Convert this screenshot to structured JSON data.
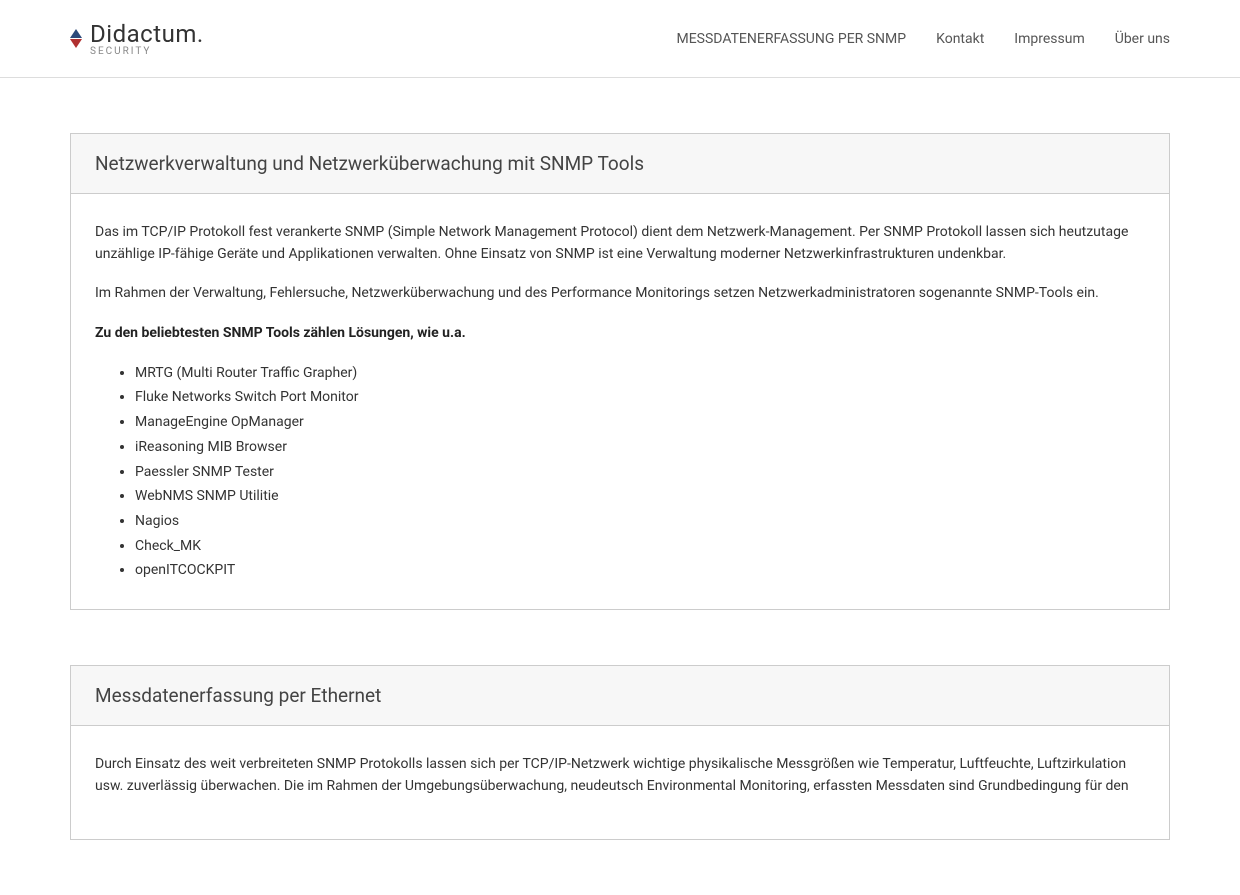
{
  "logo": {
    "name": "Didactum.",
    "tagline": "SECURITY"
  },
  "nav": {
    "item1": "MESSDATENERFASSUNG PER SNMP",
    "item2": "Kontakt",
    "item3": "Impressum",
    "item4": "Über uns"
  },
  "panel1": {
    "title": "Netzwerkverwaltung und Netzwerküberwachung mit SNMP Tools",
    "para1": "Das im TCP/IP Protokoll fest verankerte SNMP (Simple Network Management Protocol) dient dem Netzwerk-Management. Per SNMP Protokoll lassen sich heutzutage unzählige IP-fähige Geräte und Applikationen verwalten. Ohne Einsatz von SNMP ist eine Verwaltung moderner Netzwerkinfrastrukturen undenkbar.",
    "para2": "Im Rahmen der Verwaltung, Fehlersuche, Netzwerküberwachung und des Performance Monitorings setzen Netzwerkadministratoren sogenannte SNMP-Tools ein.",
    "listIntro": "Zu den beliebtesten SNMP Tools zählen Lösungen, wie u.a.",
    "items": [
      "MRTG (Multi Router Traffic Grapher)",
      "Fluke Networks Switch Port Monitor",
      "ManageEngine OpManager",
      "iReasoning MIB Browser",
      "Paessler SNMP Tester",
      "WebNMS SNMP Utilitie",
      "Nagios",
      "Check_MK",
      "openITCOCKPIT"
    ]
  },
  "panel2": {
    "title": "Messdatenerfassung per Ethernet",
    "para1": "Durch Einsatz des weit verbreiteten SNMP Protokolls lassen sich per TCP/IP-Netzwerk wichtige physikalische Messgrößen wie Temperatur, Luftfeuchte, Luftzirkulation usw. zuverlässig überwachen. Die im Rahmen der Umgebungsüberwachung, neudeutsch Environmental Monitoring, erfassten Messdaten sind Grundbedingung für den"
  }
}
